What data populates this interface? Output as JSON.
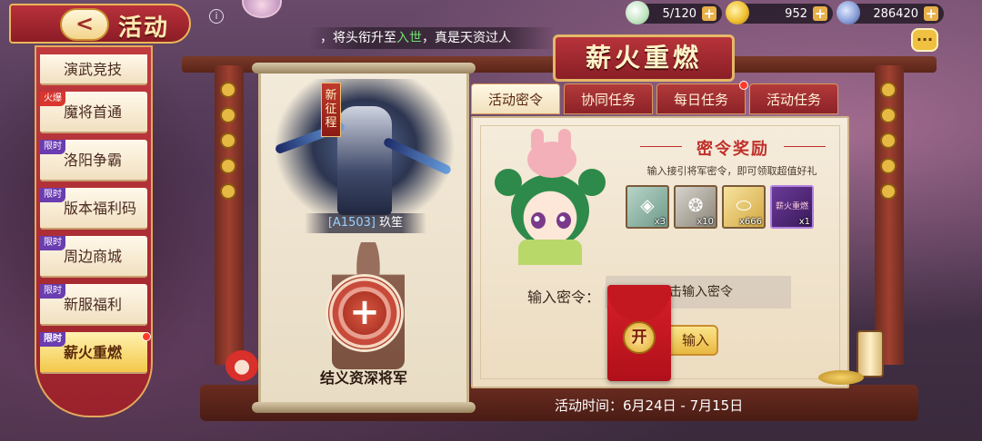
{
  "header": {
    "title": "活动",
    "back_label": "<"
  },
  "status": {
    "stamina": "5/120",
    "gold": "952",
    "coins": "286420"
  },
  "marquee": {
    "prefix": "，将头衔升至",
    "highlight": "入世",
    "suffix": "，真是天资过人"
  },
  "sidebar": {
    "items": [
      {
        "label": "演武竞技",
        "tag": ""
      },
      {
        "label": "魔将首通",
        "tag": "火爆"
      },
      {
        "label": "洛阳争霸",
        "tag": "限时"
      },
      {
        "label": "版本福利码",
        "tag": "限时"
      },
      {
        "label": "周边商城",
        "tag": "限时"
      },
      {
        "label": "新服福利",
        "tag": "限时"
      },
      {
        "label": "薪火重燃",
        "tag": "限时",
        "active": true
      }
    ]
  },
  "recruit": {
    "badge": "新征程",
    "hero_code": "[A1503]",
    "hero_name": "玖笙",
    "add_label": "结义资深将军"
  },
  "main": {
    "title": "薪火重燃",
    "tabs": [
      {
        "label": "活动密令",
        "active": true
      },
      {
        "label": "协同任务"
      },
      {
        "label": "每日任务",
        "dot": true
      },
      {
        "label": "活动任务"
      }
    ],
    "reward_title": "密令奖励",
    "reward_desc": "输入接引将军密令，即可领取超值好礼",
    "items": [
      {
        "name": "jade-token",
        "qty": "x3"
      },
      {
        "name": "scroll",
        "qty": "x10"
      },
      {
        "name": "gold-ingot",
        "qty": "x666"
      },
      {
        "name": "event-frame",
        "qty": "x1",
        "mini": "薪火重燃"
      }
    ],
    "code_label": "输入密令：",
    "code_placeholder": "击输入密令",
    "submit_label": "输入",
    "envelope_label": "开",
    "event_time": "活动时间：6月24日 - 7月15日"
  },
  "icons": {
    "info": "i",
    "chat": "···",
    "plus": "+",
    "add": "+"
  },
  "colors": {
    "accent_red": "#b8343a",
    "gold": "#e8b04a",
    "highlight_green": "#6ee06e"
  }
}
